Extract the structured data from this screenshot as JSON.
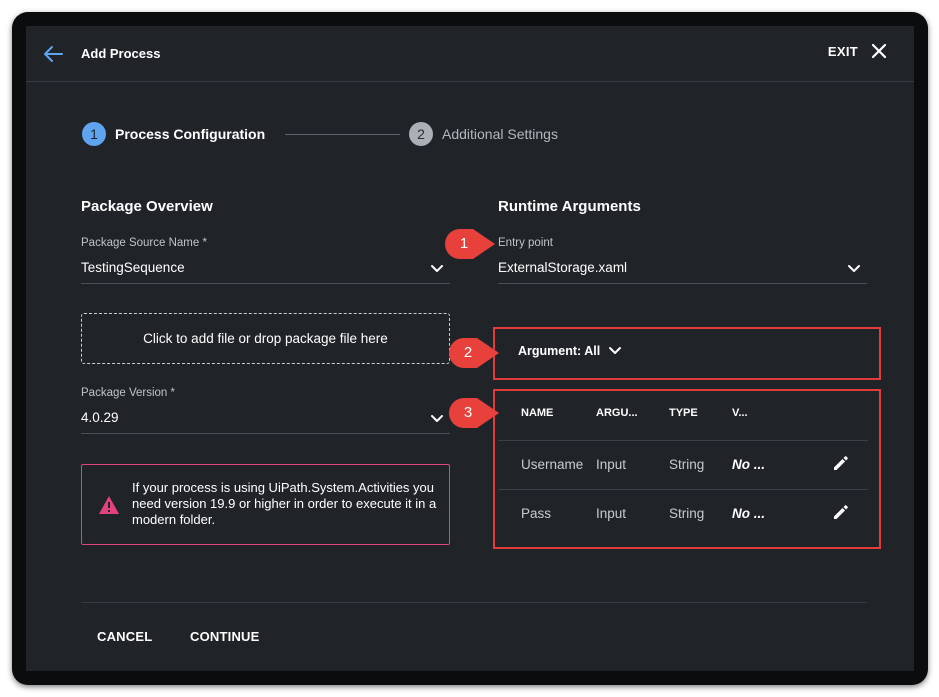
{
  "header": {
    "title": "Add Process",
    "exit_label": "EXIT"
  },
  "stepper": {
    "steps": [
      {
        "number": "1",
        "label": "Process Configuration"
      },
      {
        "number": "2",
        "label": "Additional Settings"
      }
    ]
  },
  "package": {
    "section_title": "Package Overview",
    "source_label": "Package Source Name *",
    "source_value": "TestingSequence",
    "dropzone_text": "Click to add file or drop package file here",
    "version_label": "Package Version *",
    "version_value": "4.0.29",
    "warning_text": "If your process is using UiPath.System.Activities you need version 19.9 or higher in order to execute it in a modern folder.",
    "warning_color": "#e2437a"
  },
  "runtime": {
    "section_title": "Runtime Arguments",
    "entry_label": "Entry point",
    "entry_value": "ExternalStorage.xaml",
    "argument_filter": "Argument: All",
    "columns": [
      "NAME",
      "ARGU...",
      "TYPE",
      "V..."
    ],
    "rows": [
      {
        "name": "Username",
        "direction": "Input",
        "type": "String",
        "value": "No ..."
      },
      {
        "name": "Pass",
        "direction": "Input",
        "type": "String",
        "value": "No ..."
      }
    ]
  },
  "footer": {
    "cancel_label": "CANCEL",
    "continue_label": "CONTINUE"
  },
  "callouts": [
    "1",
    "2",
    "3"
  ],
  "colors": {
    "accent": "#5fa4ee",
    "background": "#202429",
    "callout": "#e23b3b"
  }
}
